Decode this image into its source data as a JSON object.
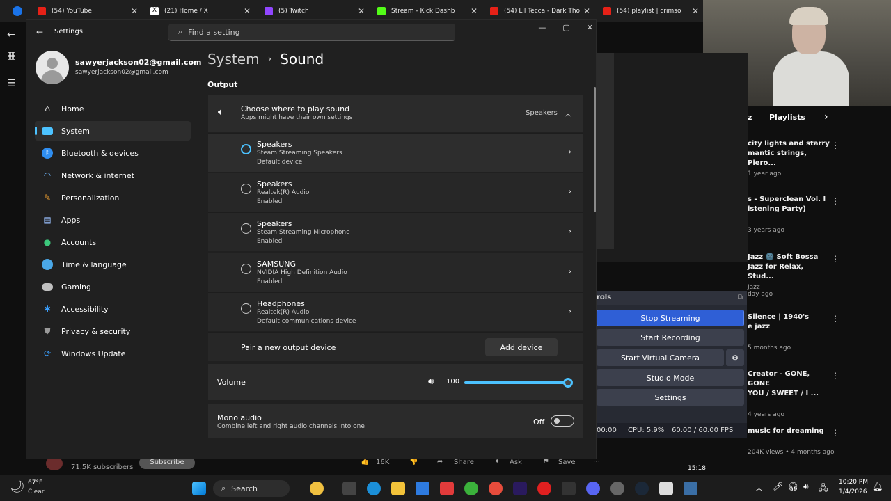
{
  "browser": {
    "tabs": [
      {
        "title": "(54) YouTube",
        "color": "#e62117"
      },
      {
        "title": "(21) Home / X",
        "color": "#ffffff"
      },
      {
        "title": "(5) Twitch",
        "color": "#9146ff"
      },
      {
        "title": "Stream - Kick Dashb",
        "color": "#53fc18"
      },
      {
        "title": "(54) Lil Tecca - Dark Tho",
        "color": "#e62117"
      },
      {
        "title": "(54) playlist | crimso",
        "color": "#e62117"
      }
    ]
  },
  "settings": {
    "window_title": "Settings",
    "search_placeholder": "Find a setting",
    "profile": {
      "name": "sawyerjackson02@gmail.com",
      "email": "sawyerjackson02@gmail.com"
    },
    "nav": [
      {
        "label": "Home",
        "icon": "home-icon",
        "color": "#e8e8e8"
      },
      {
        "label": "System",
        "icon": "monitor-icon",
        "color": "#4cc2ff"
      },
      {
        "label": "Bluetooth & devices",
        "icon": "bluetooth-icon",
        "color": "#2f8ef0"
      },
      {
        "label": "Network & internet",
        "icon": "wifi-icon",
        "color": "#6fb8ff"
      },
      {
        "label": "Personalization",
        "icon": "brush-icon",
        "color": "#f0a030"
      },
      {
        "label": "Apps",
        "icon": "apps-icon",
        "color": "#9ac0ff"
      },
      {
        "label": "Accounts",
        "icon": "person-icon",
        "color": "#3cc87c"
      },
      {
        "label": "Time & language",
        "icon": "globe-icon",
        "color": "#4aa8e8"
      },
      {
        "label": "Gaming",
        "icon": "gamepad-icon",
        "color": "#c0c0c0"
      },
      {
        "label": "Accessibility",
        "icon": "accessibility-icon",
        "color": "#3aa0ff"
      },
      {
        "label": "Privacy & security",
        "icon": "shield-icon",
        "color": "#9a9a9a"
      },
      {
        "label": "Windows Update",
        "icon": "update-icon",
        "color": "#3aa0ff"
      }
    ],
    "breadcrumb": {
      "parent": "System",
      "sep": "›",
      "current": "Sound"
    },
    "output_label": "Output",
    "choose": {
      "title": "Choose where to play sound",
      "subtitle": "Apps might have their own settings",
      "value": "Speakers"
    },
    "devices": [
      {
        "name": "Speakers",
        "driver": "Steam Streaming Speakers",
        "status": "Default device"
      },
      {
        "name": "Speakers",
        "driver": "Realtek(R) Audio",
        "status": "Enabled"
      },
      {
        "name": "Speakers",
        "driver": "Steam Streaming Microphone",
        "status": "Enabled"
      },
      {
        "name": "SAMSUNG",
        "driver": "NVIDIA High Definition Audio",
        "status": "Enabled"
      },
      {
        "name": "Headphones",
        "driver": "Realtek(R) Audio",
        "status": "Default communications device"
      }
    ],
    "pair": {
      "label": "Pair a new output device",
      "button": "Add device"
    },
    "volume": {
      "label": "Volume",
      "value": "100",
      "level": 1.0
    },
    "mono": {
      "title": "Mono audio",
      "subtitle": "Combine left and right audio channels into one",
      "state": "Off"
    }
  },
  "obs": {
    "controls_title": "rols",
    "buttons": [
      "Stop Streaming",
      "Start Recording",
      "Start Virtual Camera",
      "Studio Mode",
      "Settings"
    ],
    "status": {
      "time": "00:00",
      "cpu": "CPU: 5.9%",
      "fps": "60.00 / 60.00 FPS"
    }
  },
  "youtube": {
    "playlists_label": "Playlists",
    "items": [
      {
        "title": "city lights and starry\nmantic strings, Piero...",
        "meta": "1 year ago"
      },
      {
        "title": "s - Superclean Vol. I\nistening Party)",
        "meta": "3 years ago"
      },
      {
        "title": "Jazz 🌚 Soft Bossa\nJazz for Relax, Stud...",
        "meta": "Jazz\nday ago"
      },
      {
        "title": "Silence  |  1940's\ne jazz",
        "meta": "5 months ago"
      },
      {
        "title": "Creator - GONE, GONE\nYOU / SWEET / I ...",
        "meta": "4 years ago"
      },
      {
        "title": "music for dreaming",
        "meta": "204K views • 4 months ago"
      }
    ],
    "bottom": {
      "subs": "71.5K subscribers",
      "subscribe": "Subscribe",
      "likes": "16K",
      "share": "Share",
      "ask": "Ask",
      "save": "Save",
      "duration": "15:18"
    }
  },
  "taskbar": {
    "weather_temp": "67°F",
    "weather_cond": "Clear",
    "search": "Search",
    "time": "10:20 PM",
    "date": "1/4/2026"
  }
}
